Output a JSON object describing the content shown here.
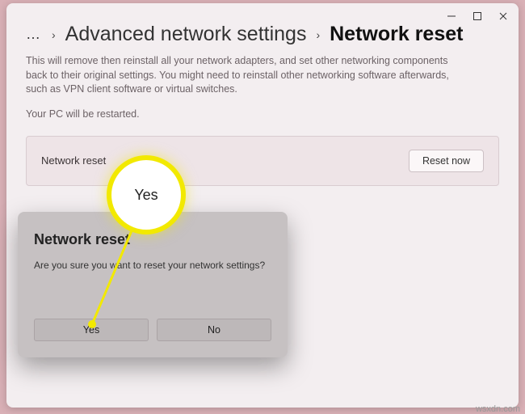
{
  "titlebar": {
    "minimize": "–",
    "maximize": "❐",
    "close": "✕"
  },
  "breadcrumb": {
    "dots": "…",
    "chev1": "›",
    "parent": "Advanced network settings",
    "chev2": "›",
    "current": "Network reset"
  },
  "description": "This will remove then reinstall all your network adapters, and set other networking components back to their original settings. You might need to reinstall other networking software afterwards, such as VPN client software or virtual switches.",
  "restart_note": "Your PC will be restarted.",
  "card": {
    "label": "Network reset",
    "button": "Reset now"
  },
  "dialog": {
    "title": "Network reset",
    "message": "Are you sure you want to reset your network settings?",
    "yes": "Yes",
    "no": "No"
  },
  "callout": {
    "text": "Yes"
  },
  "watermark": "wsxdn.com"
}
